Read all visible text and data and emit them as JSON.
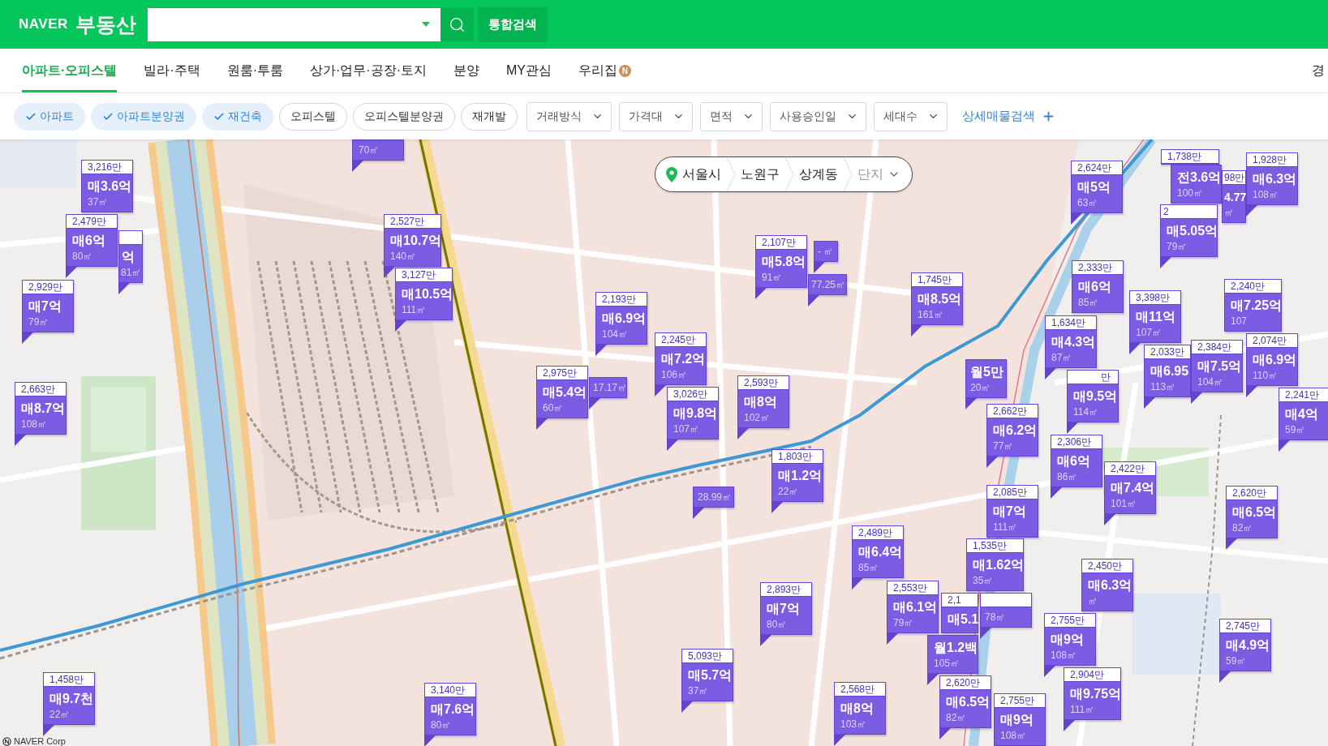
{
  "header": {
    "logo": "NAVER",
    "title": "부동산",
    "search_button": "통합검색"
  },
  "nav": {
    "tabs": [
      {
        "label": "아파트·오피스텔",
        "selected": true
      },
      {
        "label": "빌라·주택",
        "selected": false
      },
      {
        "label": "원룸·투룸",
        "selected": false
      },
      {
        "label": "상가·업무·공장·토지",
        "selected": false
      },
      {
        "label": "분양",
        "selected": false
      },
      {
        "label": "MY관심",
        "selected": false
      },
      {
        "label": "우리집",
        "selected": false,
        "badge": "N"
      }
    ],
    "right_link": "경"
  },
  "filters": {
    "chips": [
      {
        "label": "아파트",
        "checked": true
      },
      {
        "label": "아파트분양권",
        "checked": true
      },
      {
        "label": "재건축",
        "checked": true
      },
      {
        "label": "오피스텔",
        "checked": false
      },
      {
        "label": "오피스텔분양권",
        "checked": false
      },
      {
        "label": "재개발",
        "checked": false
      }
    ],
    "dropdowns": [
      "거래방식",
      "가격대",
      "면적",
      "사용승인일",
      "세대수"
    ],
    "detail_search": "상세매물검색"
  },
  "map": {
    "location_bar": {
      "path": [
        "서울시",
        "노원구",
        "상계동"
      ],
      "complex_select": {
        "placeholder": "단지"
      }
    },
    "markers": [
      {
        "kind": "full",
        "unit_price": "3,216만",
        "deal": "매3.6억",
        "area": "37㎡"
      },
      {
        "kind": "tag",
        "area": "70㎡"
      },
      {
        "kind": "full",
        "unit_price": "2,624만",
        "deal": "매5억",
        "area": "63㎡"
      },
      {
        "kind": "full",
        "unit_price": "1,738만"
      },
      {
        "kind": "compact",
        "deal": "전3.6억",
        "area": "100㎡"
      },
      {
        "kind": "full",
        "unit_price": "98만",
        "deal": "4.77",
        "area": "㎡"
      },
      {
        "kind": "full",
        "unit_price": "1,928만",
        "deal": "매6.3억",
        "area": "108㎡"
      },
      {
        "kind": "full",
        "unit_price": "2,479만",
        "deal": "매6억",
        "area": "80㎡"
      },
      {
        "kind": "full",
        "unit_price": "2,527만",
        "deal": "매10.7억",
        "area": "140㎡"
      },
      {
        "kind": "full",
        "unit_price": "2",
        "deal": "매5.05억",
        "area": "79㎡"
      },
      {
        "kind": "full",
        "deal": "억",
        "area": "81㎡"
      },
      {
        "kind": "full",
        "unit_price": "2,107만",
        "deal": "매5.8억",
        "area": "91㎡"
      },
      {
        "kind": "tag",
        "area": "- ㎡"
      },
      {
        "kind": "full",
        "unit_price": "2,929만",
        "deal": "매7억",
        "area": "79㎡"
      },
      {
        "kind": "full",
        "unit_price": "3,127만",
        "deal": "매10.5억",
        "area": "111㎡"
      },
      {
        "kind": "full",
        "unit_price": "2,193만",
        "deal": "매6.9억",
        "area": "104㎡"
      },
      {
        "kind": "tag",
        "area": "77.25㎡"
      },
      {
        "kind": "full",
        "unit_price": "1,745만",
        "deal": "매8.5억",
        "area": "161㎡"
      },
      {
        "kind": "full",
        "unit_price": "2,333만",
        "deal": "매6억",
        "area": "85㎡"
      },
      {
        "kind": "full",
        "unit_price": "3,398만",
        "deal": "매11억",
        "area": "107㎡"
      },
      {
        "kind": "full",
        "unit_price": "2,240만",
        "deal": "매7.25억",
        "area": "107"
      },
      {
        "kind": "full",
        "unit_price": "1,634만",
        "deal": "매4.3억",
        "area": "87㎡"
      },
      {
        "kind": "full",
        "unit_price": "2,245만",
        "deal": "매7.2억",
        "area": "106㎡"
      },
      {
        "kind": "full",
        "unit_price": "2,033만",
        "deal": "매6.95",
        "area": "113㎡"
      },
      {
        "kind": "full",
        "unit_price": "2,384만",
        "deal": "매7.5억",
        "area": "104㎡"
      },
      {
        "kind": "full",
        "unit_price": "2,074만",
        "deal": "매6.9억",
        "area": "110㎡"
      },
      {
        "kind": "full",
        "unit_price": "2,663만",
        "deal": "매8.7억",
        "area": "108㎡"
      },
      {
        "kind": "full",
        "unit_price": "2,975만",
        "deal": "매5.4억",
        "area": "60㎡"
      },
      {
        "kind": "tag",
        "area": "17.17㎡"
      },
      {
        "kind": "full",
        "unit_price": "3,026만",
        "deal": "매9.8억",
        "area": "107㎡"
      },
      {
        "kind": "full",
        "unit_price": "2,593만",
        "deal": "매8억",
        "area": "102㎡"
      },
      {
        "kind": "compact",
        "deal": "월5만",
        "area": "20㎡"
      },
      {
        "kind": "full",
        "unit_price": "만",
        "deal": "매9.5억",
        "area": "114㎡"
      },
      {
        "kind": "full",
        "unit_price": "2,241만",
        "deal": "매4억",
        "area": "59㎡"
      },
      {
        "kind": "full",
        "unit_price": "2,662만",
        "deal": "매6.2억",
        "area": "77㎡"
      },
      {
        "kind": "full",
        "unit_price": "2,306만",
        "deal": "매6억",
        "area": "86㎡"
      },
      {
        "kind": "full",
        "unit_price": "1,803만",
        "deal": "매1.2억",
        "area": "22㎡"
      },
      {
        "kind": "full",
        "unit_price": "2,422만",
        "deal": "매7.4억",
        "area": "101㎡"
      },
      {
        "kind": "tag",
        "area": "28.99㎡"
      },
      {
        "kind": "full",
        "unit_price": "2,085만",
        "deal": "매7억",
        "area": "111㎡"
      },
      {
        "kind": "full",
        "unit_price": "2,620만",
        "deal": "매6.5억",
        "area": "82㎡"
      },
      {
        "kind": "full",
        "unit_price": "2,489만",
        "deal": "매6.4억",
        "area": "85㎡"
      },
      {
        "kind": "full",
        "unit_price": "1,535만",
        "deal": "매1.62억",
        "area": "35㎡"
      },
      {
        "kind": "full",
        "unit_price": "2,450만",
        "deal": "매6.3억",
        "area": "㎡"
      },
      {
        "kind": "full",
        "unit_price": "2,893만",
        "deal": "매7억",
        "area": "80㎡"
      },
      {
        "kind": "full",
        "unit_price": "2,553만",
        "deal": "매6.1억",
        "area": "79㎡"
      },
      {
        "kind": "full",
        "unit_price": "2,1",
        "deal": "매5.1"
      },
      {
        "kind": "full",
        "area": "78㎡"
      },
      {
        "kind": "compact",
        "deal": "월1.2백",
        "area": "105㎡"
      },
      {
        "kind": "full",
        "unit_price": "2,755만",
        "deal": "매9억",
        "area": "108㎡"
      },
      {
        "kind": "full",
        "unit_price": "2,745만",
        "deal": "매4.9억",
        "area": "59㎡"
      },
      {
        "kind": "full",
        "unit_price": "5,093만",
        "deal": "매5.7억",
        "area": "37㎡"
      },
      {
        "kind": "full",
        "unit_price": "1,458만",
        "deal": "매9.7천",
        "area": "22㎡"
      },
      {
        "kind": "full",
        "unit_price": "3,140만",
        "deal": "매7.6억",
        "area": "80㎡"
      },
      {
        "kind": "full",
        "unit_price": "2,568만",
        "deal": "매8억",
        "area": "103㎡"
      },
      {
        "kind": "full",
        "unit_price": "2,620만",
        "deal": "매6.5억",
        "area": "82㎡"
      },
      {
        "kind": "full",
        "unit_price": "2,755만",
        "deal": "매9억",
        "area": "108㎡"
      },
      {
        "kind": "full",
        "unit_price": "2,904만",
        "deal": "매9.75억",
        "area": "111㎡"
      }
    ],
    "credit": "NAVER Corp"
  }
}
